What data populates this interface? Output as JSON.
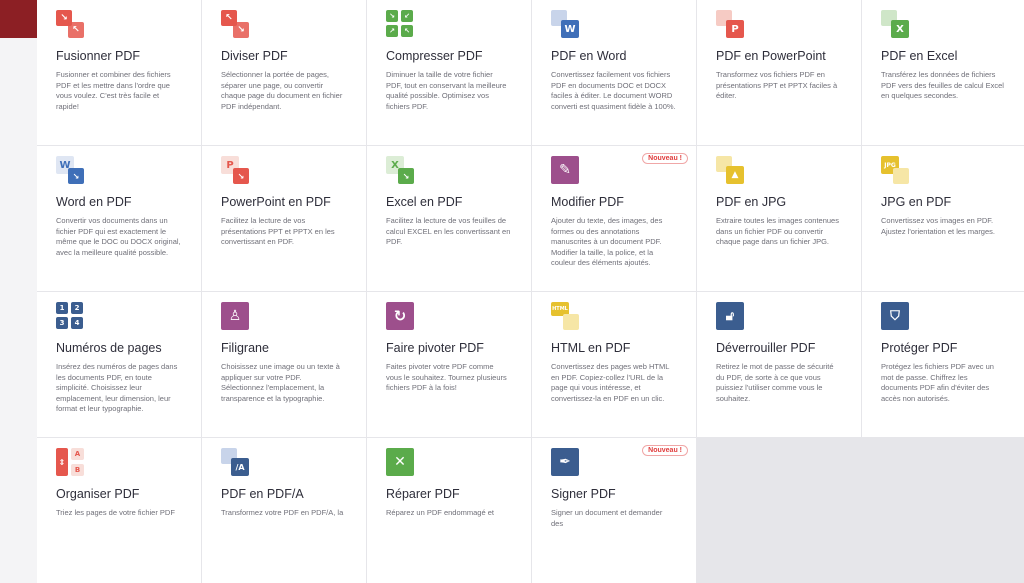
{
  "colors": {
    "red": "#e5574d",
    "green": "#5bab4b",
    "blue": "#3f6fb8",
    "purple": "#9d4f8c",
    "yellow": "#e6c12e",
    "navy": "#3b5d8f",
    "badge": "#e03c3c"
  },
  "badge_label": "Nouveau !",
  "tools": [
    {
      "title": "Fusionner PDF",
      "icon": "merge-icon",
      "description": "Fusionner et combiner des fichiers PDF et les mettre dans l'ordre que vous voulez. C'est très facile et rapide!"
    },
    {
      "title": "Diviser PDF",
      "icon": "split-icon",
      "description": "Sélectionner la portée de pages, séparer une page, ou convertir chaque page du document en fichier PDF indépendant."
    },
    {
      "title": "Compresser PDF",
      "icon": "compress-icon",
      "description": "Diminuer la taille de votre fichier PDF, tout en conservant la meilleure qualité possible. Optimisez vos fichiers PDF."
    },
    {
      "title": "PDF en Word",
      "icon": "pdf-to-word-icon",
      "description": "Convertissez facilement vos fichiers PDF en documents DOC et DOCX faciles à éditer. Le document WORD converti est quasiment fidèle à 100%."
    },
    {
      "title": "PDF en PowerPoint",
      "icon": "pdf-to-powerpoint-icon",
      "description": "Transformez vos fichiers PDF en présentations PPT et PPTX faciles à éditer."
    },
    {
      "title": "PDF en Excel",
      "icon": "pdf-to-excel-icon",
      "description": "Transférez les données de fichiers PDF vers des feuilles de calcul Excel en quelques secondes."
    },
    {
      "title": "Word en PDF",
      "icon": "word-to-pdf-icon",
      "description": "Convertir vos documents dans un fichier PDF qui est exactement le même que le DOC ou DOCX original, avec la meilleure qualité possible."
    },
    {
      "title": "PowerPoint en PDF",
      "icon": "powerpoint-to-pdf-icon",
      "description": "Facilitez la lecture de vos présentations PPT et PPTX en les convertissant en PDF."
    },
    {
      "title": "Excel en PDF",
      "icon": "excel-to-pdf-icon",
      "description": "Facilitez la lecture de vos feuilles de calcul EXCEL en les convertissant en PDF."
    },
    {
      "title": "Modifier PDF",
      "icon": "edit-pdf-icon",
      "badge": true,
      "description": "Ajouter du texte, des images, des formes ou des annotations manuscrites à un document PDF. Modifier la taille, la police, et la couleur des éléments ajoutés."
    },
    {
      "title": "PDF en JPG",
      "icon": "pdf-to-jpg-icon",
      "description": "Extraire toutes les images contenues dans un fichier PDF ou convertir chaque page dans un fichier JPG."
    },
    {
      "title": "JPG en PDF",
      "icon": "jpg-to-pdf-icon",
      "description": "Convertissez vos images en PDF. Ajustez l'orientation et les marges."
    },
    {
      "title": "Numéros de pages",
      "icon": "page-numbers-icon",
      "description": "Insérez des numéros de pages dans les documents PDF, en toute simplicité. Choisissez leur emplacement, leur dimension, leur format et leur typographie."
    },
    {
      "title": "Filigrane",
      "icon": "watermark-icon",
      "description": "Choisissez une image ou un texte à appliquer sur votre PDF. Sélectionnez l'emplacement, la transparence et la typographie."
    },
    {
      "title": "Faire pivoter PDF",
      "icon": "rotate-icon",
      "description": "Faites pivoter votre PDF comme vous le souhaitez. Tournez plusieurs fichiers PDF à la fois!"
    },
    {
      "title": "HTML en PDF",
      "icon": "html-to-pdf-icon",
      "description": "Convertissez des pages web HTML en PDF. Copiez-collez l'URL de la page qui vous intéresse, et convertissez-la en PDF en un clic."
    },
    {
      "title": "Déverrouiller PDF",
      "icon": "unlock-icon",
      "description": "Retirez le mot de passe de sécurité du PDF, de sorte à ce que vous puissiez l'utiliser comme vous le souhaitez."
    },
    {
      "title": "Protéger PDF",
      "icon": "protect-icon",
      "description": "Protégez les fichiers PDF avec un mot de passe. Chiffrez les documents PDF afin d'éviter des accès non autorisés."
    },
    {
      "title": "Organiser PDF",
      "icon": "organize-icon",
      "description": "Triez les pages de votre fichier PDF"
    },
    {
      "title": "PDF en PDF/A",
      "icon": "pdf-to-pdfa-icon",
      "description": "Transformez votre PDF en PDF/A, la"
    },
    {
      "title": "Réparer PDF",
      "icon": "repair-icon",
      "description": "Réparez un PDF endommagé et"
    },
    {
      "title": "Signer PDF",
      "icon": "sign-icon",
      "badge": true,
      "description": "Signer un document et demander des"
    }
  ]
}
